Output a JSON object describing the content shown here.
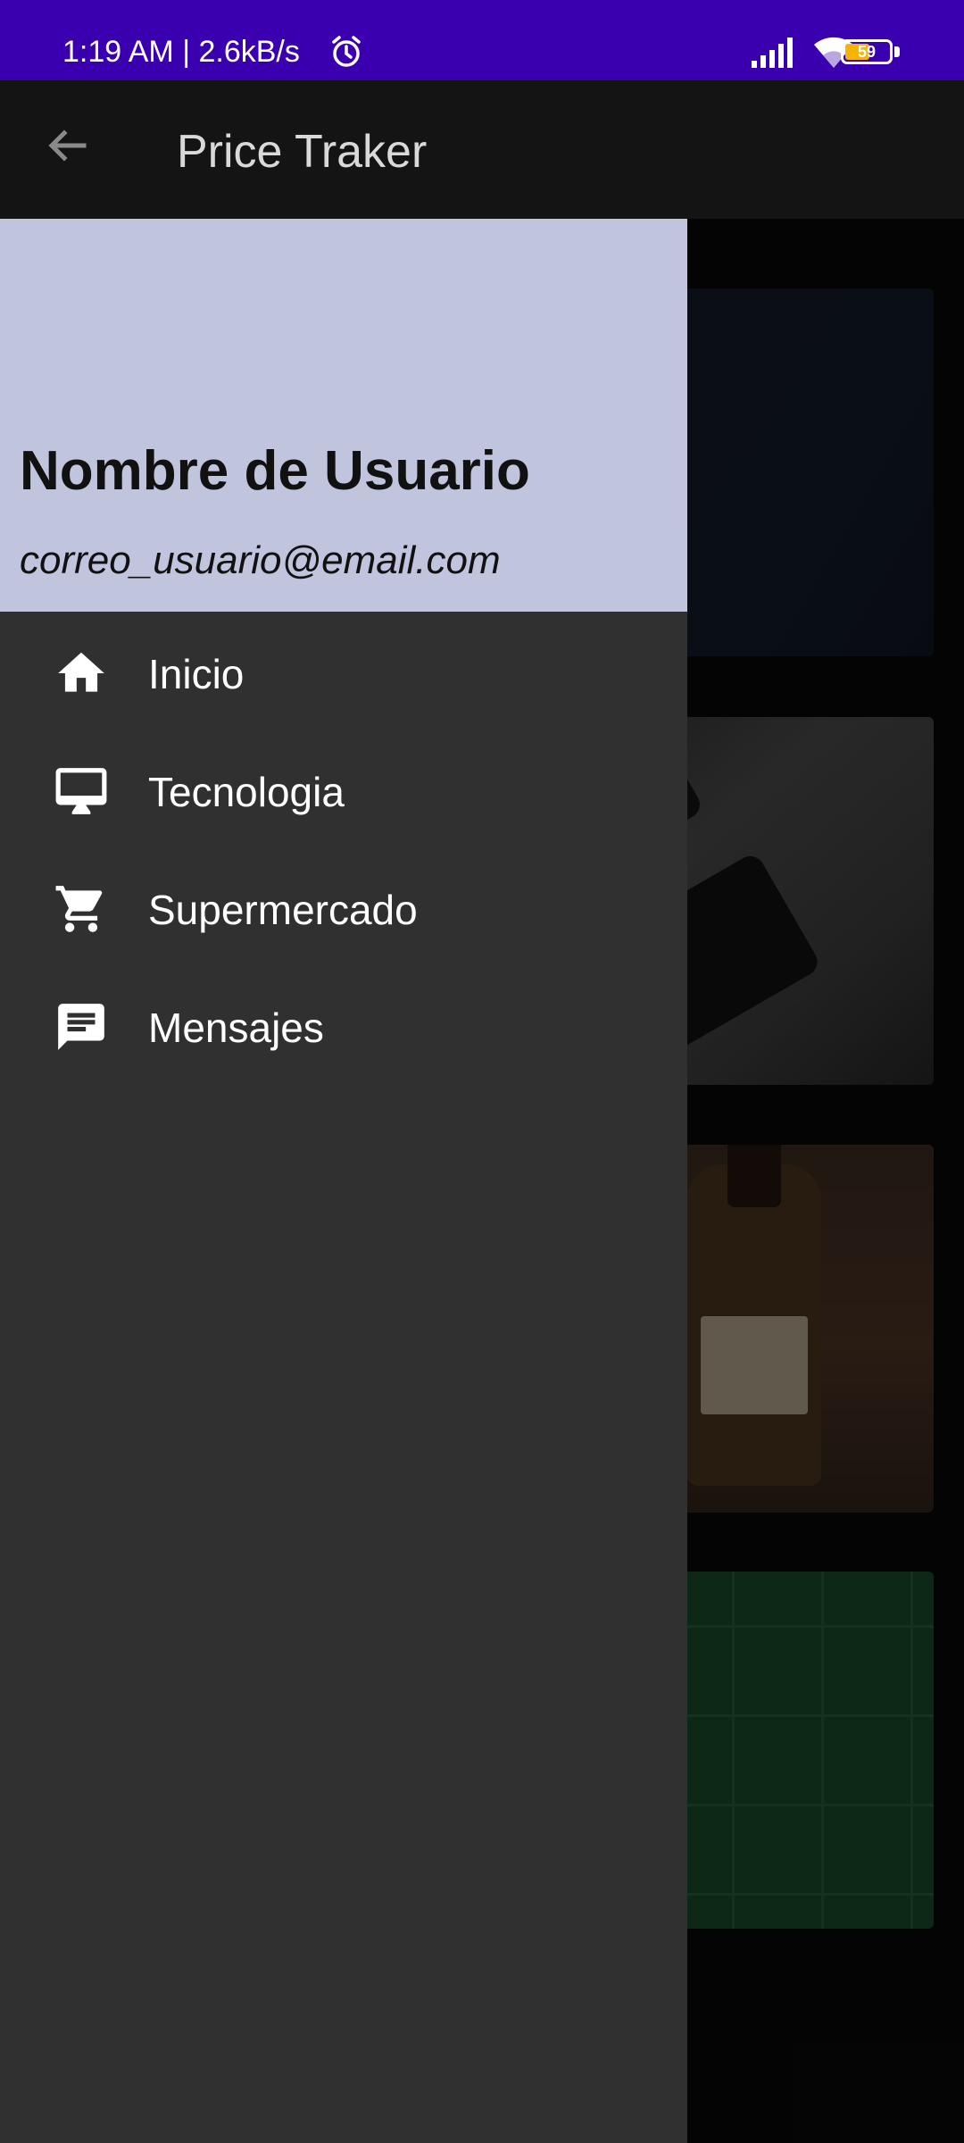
{
  "status_bar": {
    "time_text": "1:19 AM | 2.6kB/s",
    "battery_level": "59",
    "background_color": "#3a00b0",
    "icons": [
      "alarm-icon",
      "signal-icon",
      "wifi-icon",
      "battery-icon"
    ]
  },
  "app_bar": {
    "title": "Price Traker",
    "back_icon": "arrow-back-icon"
  },
  "drawer": {
    "user_name": "Nombre de Usuario",
    "user_email": "correo_usuario@email.com",
    "header_color": "#c0c4dc",
    "background_color": "#303030",
    "items": [
      {
        "label": "Inicio",
        "icon": "home-icon"
      },
      {
        "label": "Tecnologia",
        "icon": "desktop-icon"
      },
      {
        "label": "Supermercado",
        "icon": "shopping-cart-icon"
      },
      {
        "label": "Mensajes",
        "icon": "message-icon"
      }
    ]
  },
  "background_cards": [
    {
      "name": "card-tablet-image"
    },
    {
      "name": "card-phones-image"
    },
    {
      "name": "card-bottles-image"
    },
    {
      "name": "card-green-image"
    }
  ]
}
